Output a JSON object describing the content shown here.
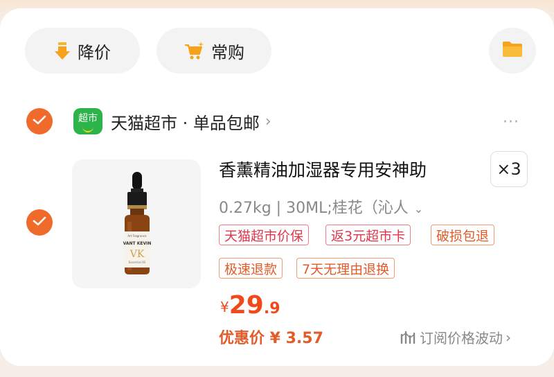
{
  "toolbar": {
    "price_drop_label": "降价",
    "frequent_buy_label": "常购"
  },
  "store": {
    "badge_text": "超市",
    "name": "天猫超市 · 单品包邮",
    "chevron": "›",
    "more": "···"
  },
  "item": {
    "title": "香薰精油加湿器专用安神助",
    "quantity": "×3",
    "spec": "0.27kg | 30ML;桂花（沁人",
    "spec_arrow": "⌄",
    "tags": [
      "天猫超市价保",
      "返3元超市卡",
      "破损包退",
      "极速退款",
      "7天无理由退换"
    ],
    "price_currency": "¥",
    "price_int": "29",
    "price_dec": ".9",
    "deal_price": "优惠价 ¥ 3.57",
    "subscribe_label": "订阅价格波动",
    "subscribe_chevron": "›",
    "bottle": {
      "brand_small": "Art Fragrance",
      "brand": "VANT KEVIN",
      "monogram": "VK",
      "sub": "Essential Oil"
    }
  },
  "colors": {
    "accent": "#f06a2b",
    "price": "#f04a1a",
    "tag_red": "#e0364a",
    "tag_orange": "#e25b29",
    "store_green": "#2cb34a"
  },
  "icons": {
    "price_drop": "down-arrow-icon",
    "frequent_buy": "cart-icon",
    "folder": "folder-icon",
    "check": "check-icon",
    "subscribe": "chart-icon"
  }
}
